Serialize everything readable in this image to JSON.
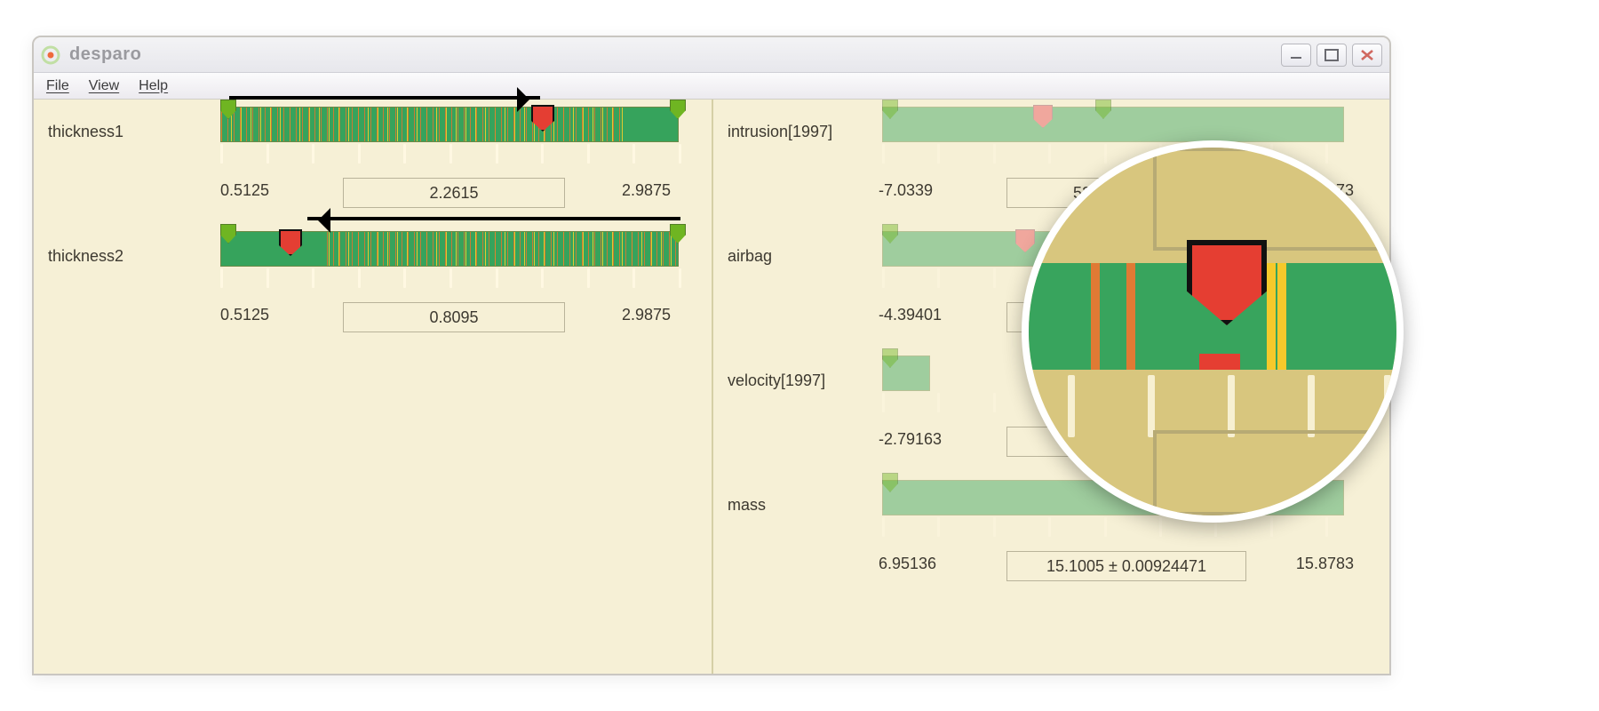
{
  "window": {
    "title": "desparo"
  },
  "menu": {
    "file": "File",
    "view": "View",
    "help": "Help"
  },
  "left_params": [
    {
      "name": "thickness1",
      "min": "0.5125",
      "max": "2.9875",
      "value": "2.2615",
      "marker_pct": 69,
      "handleL_pct": 0,
      "handleR_pct": 100
    },
    {
      "name": "thickness2",
      "min": "0.5125",
      "max": "2.9875",
      "value": "0.8095",
      "marker_pct": 15,
      "handleL_pct": 0,
      "handleR_pct": 100
    }
  ],
  "right_params": [
    {
      "name": "intrusion[1997]",
      "min": "-7.0339",
      "max": "73.1373",
      "value": "52.461 ± 7.461",
      "marker_pct": 35,
      "handleL_pct": 0,
      "handleR_pct": 48
    },
    {
      "name": "airbag",
      "min": "-4.39401",
      "max": "",
      "value": "",
      "marker_pct": 30,
      "handleL_pct": 0,
      "handleR_pct": 100
    },
    {
      "name": "velocity[1997]",
      "min": "-2.79163",
      "max": "",
      "value": "",
      "marker_pct": 12,
      "handleL_pct": 0,
      "handleR_pct": 8
    },
    {
      "name": "mass",
      "min": "6.95136",
      "max": "15.8783",
      "value": "15.1005 ± 0.00924471",
      "marker_pct": 90,
      "handleL_pct": 0,
      "handleR_pct": 100
    }
  ]
}
